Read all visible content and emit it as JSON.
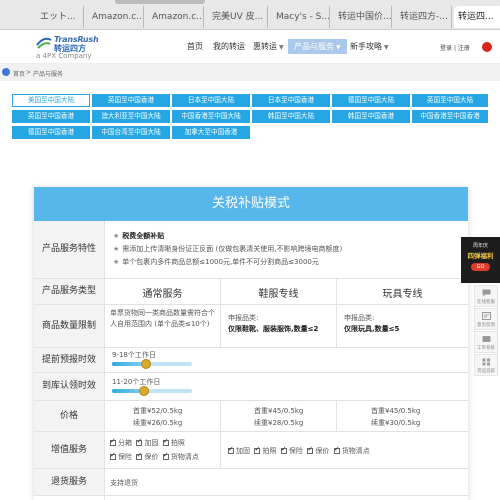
{
  "browser": {
    "tabs": [
      {
        "label": "エット..."
      },
      {
        "label": "Amazon.c..."
      },
      {
        "label": "Amazon.c..."
      },
      {
        "label": "完美UV 皮..."
      },
      {
        "label": "Macy's - S..."
      },
      {
        "label": "转运中国价..."
      },
      {
        "label": "转运四方-..."
      },
      {
        "label": "转运四..."
      }
    ]
  },
  "header": {
    "logo_en": "TransRush",
    "logo_cn": "转运四方",
    "logo_sub": "a 4PX Company",
    "nav": [
      {
        "label": "首页"
      },
      {
        "label": "我的转运"
      },
      {
        "label": "惠转运"
      },
      {
        "label": "产品与服务"
      },
      {
        "label": "新手攻略"
      }
    ],
    "login": "登录",
    "register": "注册",
    "sep": "|"
  },
  "breadcrumb": {
    "home": "首页",
    "arrow": ">",
    "current": "产品与服务"
  },
  "routes": [
    {
      "label": "美国至中国大陆"
    },
    {
      "label": "英国至中国香港"
    },
    {
      "label": "日本至中国大陆"
    },
    {
      "label": "日本至中国香港"
    },
    {
      "label": "德国至中国大陆"
    },
    {
      "label": "英国至中国大陆"
    },
    {
      "label": "英国至中国香港"
    },
    {
      "label": "澳大利亚至中国大陆"
    },
    {
      "label": "中国香港至中国大陆"
    },
    {
      "label": "韩国至中国大陆"
    },
    {
      "label": "韩国至中国香港"
    },
    {
      "label": "中国香港至中国香港"
    },
    {
      "label": "德国至中国香港"
    },
    {
      "label": "中国台湾至中国大陆"
    },
    {
      "label": "加拿大至中国香港"
    }
  ],
  "card": {
    "title": "关税补贴模式",
    "labels": {
      "features": "产品服务特性",
      "type": "产品服务类型",
      "limit": "商品数量限制",
      "forecast": "提前预报时效",
      "arrival": "到库认领时效",
      "price": "价格",
      "addon": "增值服务",
      "return": "退货服务"
    },
    "features": [
      "税费全额补贴",
      "需添加上传清晰身份证正反面 (仅做包裹清关使用,不影响跨境电商额度)",
      "单个包裹内多件商品总额≤1000元,单件不可分割商品≤3000元"
    ],
    "columns": {
      "general": "通常服务",
      "shoes": "鞋服专线",
      "toys": "玩具专线"
    },
    "limit_general": "单票货物同一类商品数量需符合个人自用范围内 (单个品类≤10个)",
    "limit_shoes_label": "申报品类:",
    "limit_shoes": "仅限鞋靴、服装服饰,数量≤2",
    "limit_toys_label": "申报品类:",
    "limit_toys": "仅限玩具,数量≤5",
    "forecast_text": "9-18个工作日",
    "forecast_level": 0.42,
    "arrival_text": "11-20个工作日",
    "arrival_level": 0.4,
    "prices": {
      "general": {
        "first": "首重¥52/0.5kg",
        "cont": "续重¥26/0.5kg"
      },
      "shoes": {
        "first": "首重¥45/0.5kg",
        "cont": "续重¥28/0.5kg"
      },
      "toys": {
        "first": "首重¥45/0.5kg",
        "cont": "续重¥30/0.5kg"
      }
    },
    "addon_general_1": [
      "分箱",
      "加固",
      "拍照"
    ],
    "addon_general_2": [
      "保险",
      "保价",
      "货物清点"
    ],
    "addon_wide": [
      "加固",
      "拍照",
      "保险",
      "保价",
      "货物清点"
    ],
    "return_text": "支持退货"
  },
  "float": {
    "promo_a": "周年庆",
    "promo_b": "四弹福利",
    "promo_c": "GO",
    "side": [
      {
        "label": "在线客服"
      },
      {
        "label": "意见反馈"
      },
      {
        "label": "工单系统"
      },
      {
        "label": "货运追踪"
      }
    ]
  },
  "colors": {
    "accent": "#26a7e4",
    "title_bar": "#57b6ea",
    "brand": "#3b6cb7"
  }
}
